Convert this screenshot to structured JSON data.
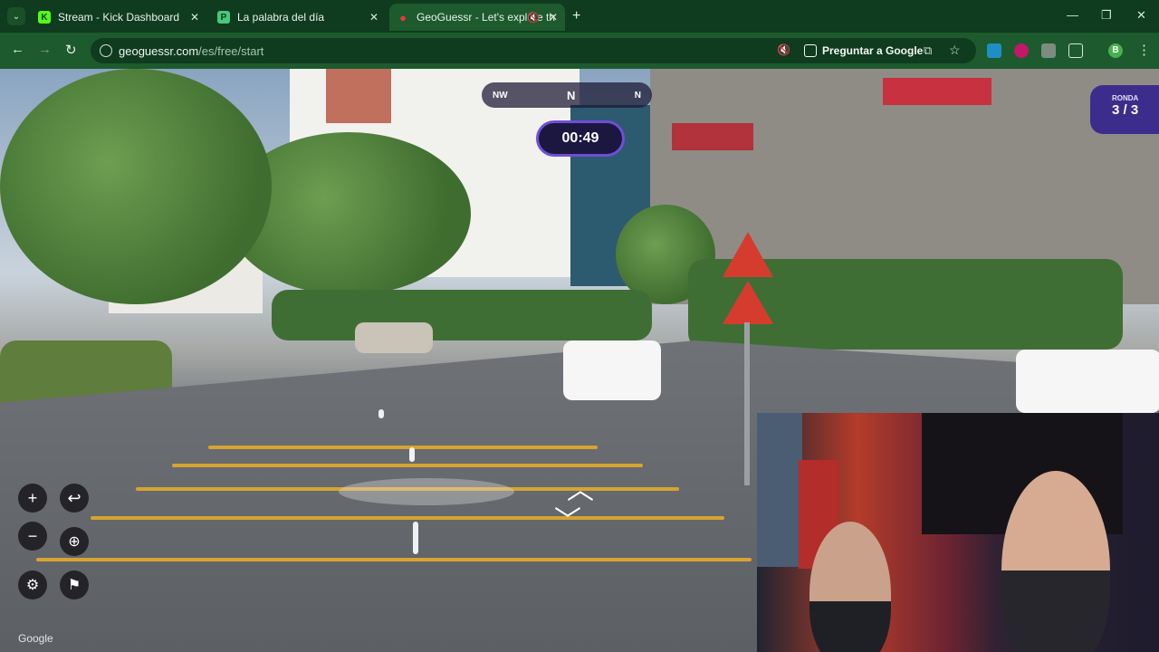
{
  "tabs": [
    {
      "title": "Stream - Kick Dashboard",
      "favicon": "K",
      "favicon_color": "#53fc18"
    },
    {
      "title": "La palabra del día",
      "favicon": "P",
      "favicon_color": "#47c87a"
    },
    {
      "title": "GeoGuessr - Let's explore th",
      "favicon": "pin-icon",
      "favicon_color": "#e23b3b"
    }
  ],
  "toolbar": {
    "url_host": "geoguessr.com",
    "url_path": "/es/free/start",
    "ask_google": "Preguntar a Google",
    "profile_initial": "B"
  },
  "game": {
    "compass": {
      "left": "NW",
      "center": "N",
      "right": "N"
    },
    "timer": "00:49",
    "round_label": "RONDA",
    "round_value": "3 / 3"
  },
  "map_attribution": "Google",
  "colors": {
    "browser_frame": "#0f3b1f",
    "browser_toolbar": "#1d5a2d",
    "accent": "#6f4fd6"
  }
}
